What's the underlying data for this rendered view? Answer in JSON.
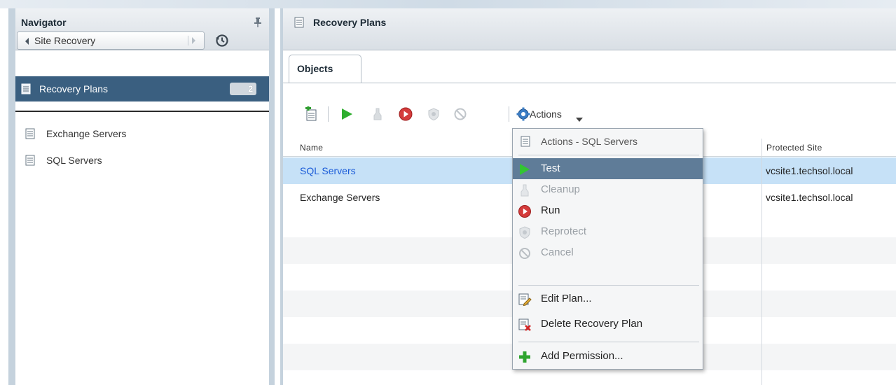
{
  "navigator": {
    "title": "Navigator",
    "breadcrumb": "Site Recovery",
    "selected": {
      "label": "Recovery Plans",
      "badge": "2"
    },
    "items": [
      {
        "label": "Exchange Servers"
      },
      {
        "label": "SQL Servers"
      }
    ]
  },
  "main": {
    "title": "Recovery Plans",
    "tabs": [
      {
        "label": "Objects"
      }
    ],
    "toolbar": {
      "actions_label": "Actions"
    },
    "table": {
      "columns": [
        "Name",
        "Protected Site"
      ],
      "rows": [
        {
          "name": "SQL Servers",
          "protected_site": "vcsite1.techsol.local",
          "selected": true
        },
        {
          "name": "Exchange Servers",
          "protected_site": "vcsite1.techsol.local",
          "selected": false
        }
      ]
    }
  },
  "context_menu": {
    "title": "Actions - SQL Servers",
    "items": [
      {
        "label": "Test",
        "icon": "play-icon",
        "enabled": true,
        "highlighted": true
      },
      {
        "label": "Cleanup",
        "icon": "cleanup-icon",
        "enabled": false
      },
      {
        "label": "Run",
        "icon": "run-icon",
        "enabled": true
      },
      {
        "label": "Reprotect",
        "icon": "shield-icon",
        "enabled": false
      },
      {
        "label": "Cancel",
        "icon": "cancel-icon",
        "enabled": false
      },
      {
        "label": "Edit Plan...",
        "icon": "edit-icon",
        "enabled": true
      },
      {
        "label": "Delete Recovery Plan",
        "icon": "delete-icon",
        "enabled": true
      },
      {
        "label": "Add Permission...",
        "icon": "add-icon",
        "enabled": true
      }
    ]
  },
  "colors": {
    "selection_dark": "#3a5f80",
    "row_selected": "#c6e1f7",
    "menu_highlight": "#5f7c98",
    "link_blue": "#1a5bd8"
  }
}
